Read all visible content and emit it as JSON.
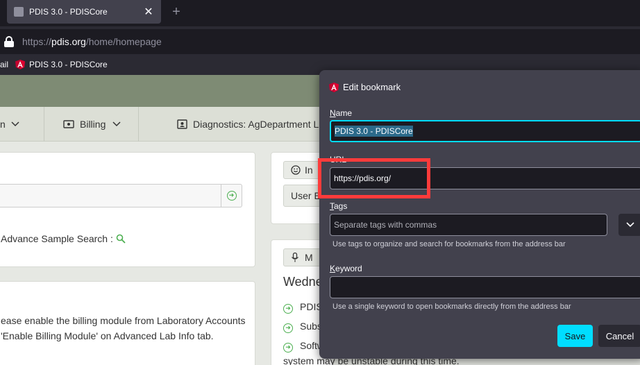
{
  "tab": {
    "title": "PDIS 3.0 - PDISCore",
    "close_glyph": "✕"
  },
  "newtab_glyph": "+",
  "urlbar": {
    "url_prefix": "https://",
    "url_host": "pdis.org",
    "url_path": "/home/homepage"
  },
  "bookmarks": [
    {
      "label": "ail"
    },
    {
      "label": "PDIS 3.0 - PDISCore"
    }
  ],
  "page": {
    "menu": [
      {
        "label": "n"
      },
      {
        "label": "Billing"
      },
      {
        "label": "Diagnostics: AgDepartment La"
      }
    ],
    "advance_search_label": "Advance Sample Search :",
    "pill_1": "In",
    "pill_2": "User E",
    "pill_3": "M",
    "date_heading": "Wedne",
    "billing_line_1": "ease enable the billing module from Laboratory Accounts",
    "billing_line_2": "'Enable Billing Module' on Advanced Lab Info tab.",
    "news_items": [
      "PDIS",
      "Subs",
      "Softw"
    ],
    "news_footer": "system may be unstable during this time."
  },
  "dialog": {
    "title": "Edit bookmark",
    "name_label": "Name",
    "name_value": "PDIS 3.0 - PDISCore",
    "url_label": "URL",
    "url_value": "https://pdis.org/",
    "tags_label": "Tags",
    "tags_placeholder": "Separate tags with commas",
    "tags_hint": "Use tags to organize and search for bookmarks from the address bar",
    "keyword_label": "Keyword",
    "keyword_value": "",
    "keyword_hint": "Use a single keyword to open bookmarks directly from the address bar",
    "save_label": "Save",
    "cancel_label": "Cancel"
  },
  "colors": {
    "accent": "#00ddff",
    "highlight": "#ff3b3b",
    "dialog_bg": "#42414d",
    "page_header": "#7e8b74"
  }
}
